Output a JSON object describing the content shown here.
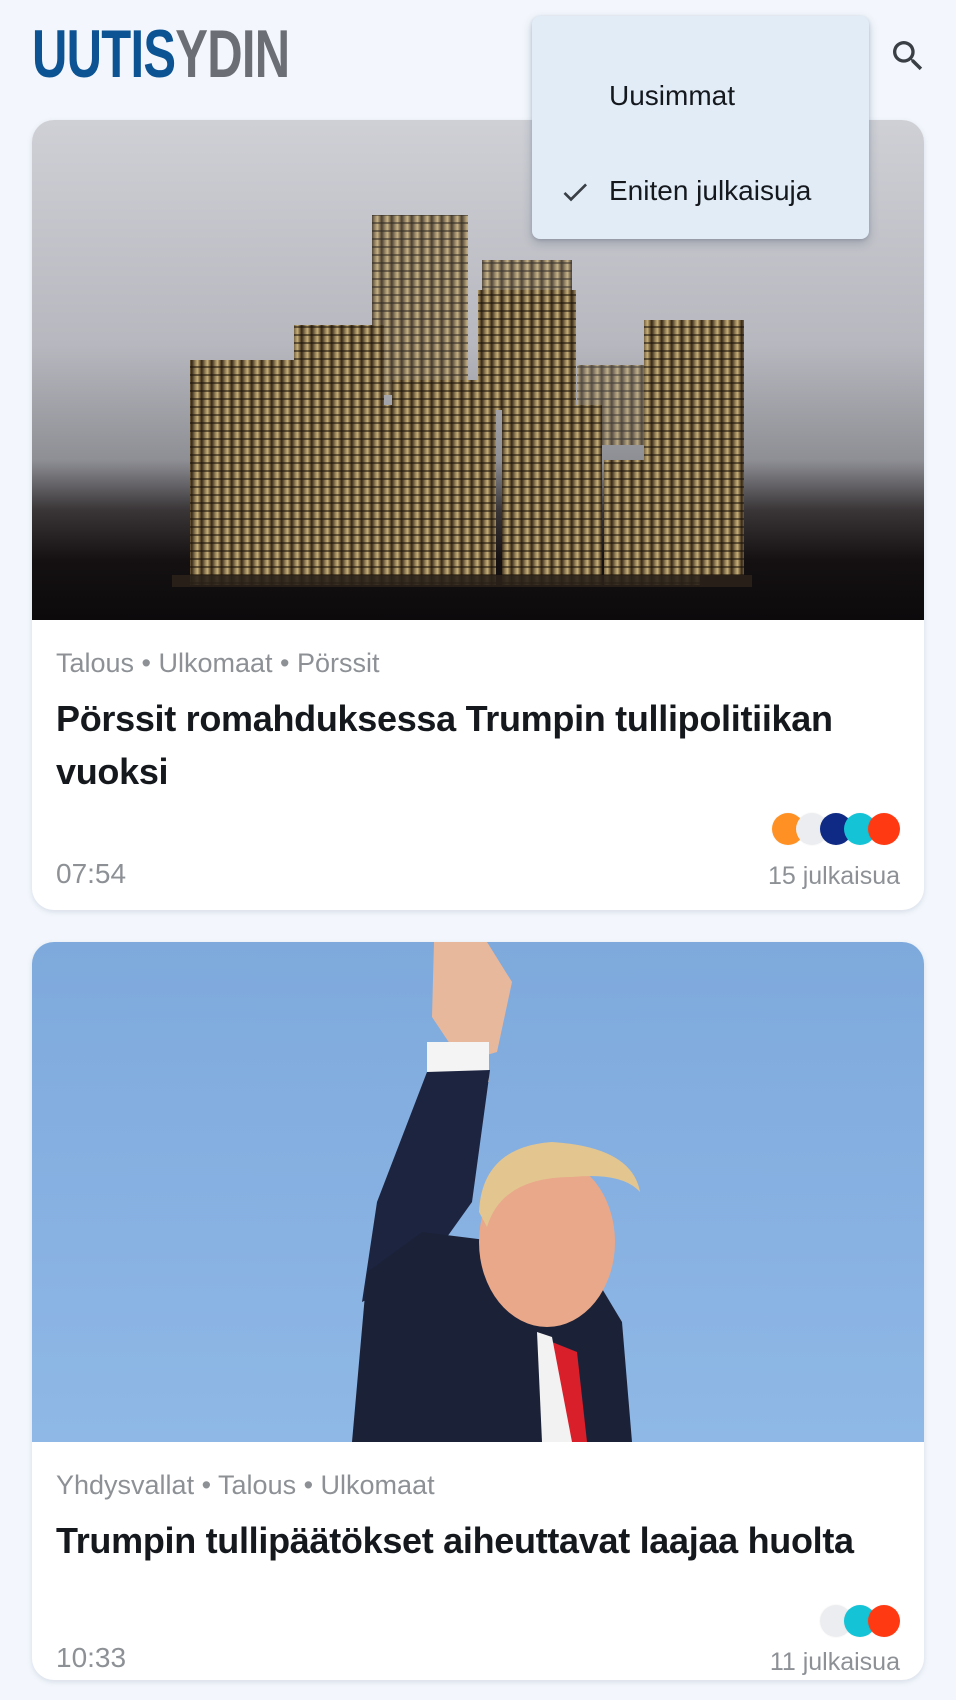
{
  "app": {
    "logo_part1": "UUTIS",
    "logo_part2": "YDIN",
    "brand_colors": {
      "primary": "#0b5393",
      "secondary": "#6b6f75"
    }
  },
  "header": {
    "search_icon": "search-icon"
  },
  "sort_menu": {
    "items": [
      {
        "label": "Uusimmat",
        "selected": false
      },
      {
        "label": "Eniten julkaisuja",
        "selected": true
      }
    ]
  },
  "articles": [
    {
      "image": "stacks-of-coins-photo",
      "categories": "Talous • Ulkomaat • Pörssit",
      "title": "Pörssit romahduksessa Trumpin tullipolitiikan vuoksi",
      "time": "07:54",
      "publications": "15 julkaisua",
      "source_colors": [
        "#ff3a12",
        "#14c3d6",
        "#0f2a84",
        "#ecedf0",
        "#ff9124"
      ]
    },
    {
      "image": "trump-waving-photo",
      "categories": "Yhdysvallat • Talous • Ulkomaat",
      "title": "Trumpin tullipäätökset aiheuttavat laajaa huolta",
      "time": "10:33",
      "publications": "11 julkaisua",
      "source_colors": [
        "#ff3a12",
        "#14c3d6",
        "#ecedf0"
      ]
    }
  ]
}
